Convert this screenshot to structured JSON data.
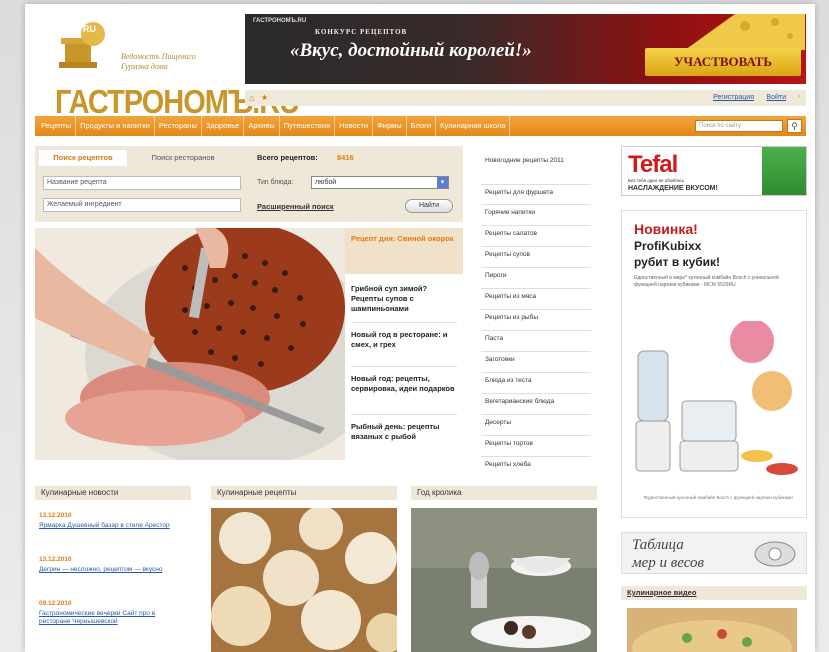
{
  "logo": {
    "tagline_1": "Ведомостъ Пищеваго",
    "tagline_2": "Гурмэна дома",
    "name": "ГАСТРОНОМЪ.RU",
    "badge": "RU"
  },
  "banner": {
    "brand": "ГАСТРОНОМЪ.RU",
    "subtitle": "КОНКУРС РЕЦЕПТОВ",
    "title": "«Вкус, достойный королей!»",
    "cta": "УЧАСТВОВАТЬ"
  },
  "subbar": {
    "register": "Регистрация",
    "login": "Войти"
  },
  "nav": {
    "items": [
      "Рецепты",
      "Продукты и напитки",
      "Рестораны",
      "Здоровье",
      "Архивы",
      "Путешествия",
      "Новости",
      "Фирмы",
      "Блоги",
      "Кулинарная школа"
    ],
    "search_placeholder": "Поиск по сайту"
  },
  "search": {
    "tab_recipes": "Поиск рецептов",
    "tab_restaurants": "Поиск ресторанов",
    "total_label": "Всего рецептов:",
    "total_count": "8416",
    "name_placeholder": "Название рецепта",
    "ingredient_placeholder": "Желаемый ингредиент",
    "dish_label": "Тип блюда:",
    "dish_value": "любой",
    "advanced": "Расширенный поиск",
    "find": "Найти"
  },
  "featured": {
    "first": "Рецепт дня: Свиной окорок",
    "items": [
      "Грибной суп зимой? Рецепты супов с шампиньонами",
      "Новый год в ресторане: и смех, и грех",
      "Новый год: рецепты, сервировка, идеи подарков",
      "Рыбный день: рецепты вязаных с рыбой"
    ]
  },
  "categories": [
    "Новогодние рецепты 2011",
    "Рецепты для фуршета",
    "Горячие напитки",
    "Рецепты салатов",
    "Рецепты супов",
    "Пироги",
    "Рецепты из мяса",
    "Рецепты из рыбы",
    "Паста",
    "Заготовки",
    "Блюда из теста",
    "Вегетарианские блюда",
    "Десерты",
    "Рецепты тортов",
    "Рецепты хлеба"
  ],
  "tefal": {
    "logo": "Tefal",
    "tag": "Без тебя одно не обойтись",
    "slogan": "НАСЛАЖДЕНИЕ ВКУСОМ!"
  },
  "promo": {
    "new": "Новинка!",
    "line1": "ProfiKubixx",
    "line2": "рубит в кубик!",
    "desc": "Единственный в мире* кухонный комбайн Bosch с уникальной функцией нарезки кубиками - MCM 5529RU",
    "foot": "*Единственный кухонный комбайн Bosch с функцией нарезки кубиками"
  },
  "measures": {
    "line1": "Таблица",
    "line2": "мер и весов"
  },
  "video": {
    "title": "Кулинарное видео"
  },
  "sections": {
    "news_title": "Кулинарные новости",
    "recipes_title": "Кулинарные рецепты",
    "rabbit_title": "Год кролика"
  },
  "news": [
    {
      "date": "13.12.2010",
      "text": "Ярмарка Душевный базар в стиле Арестор"
    },
    {
      "date": "13.12.2010",
      "text": "Дегрин — несложно, рецептом — вкусно"
    },
    {
      "date": "09.12.2010",
      "text": "Гастрономические вечерки Сайт про в ресторане Чернышевской"
    }
  ],
  "colors": {
    "accent": "#e2871a",
    "link": "#2a5aa8",
    "brand_gold": "#c9962a"
  }
}
